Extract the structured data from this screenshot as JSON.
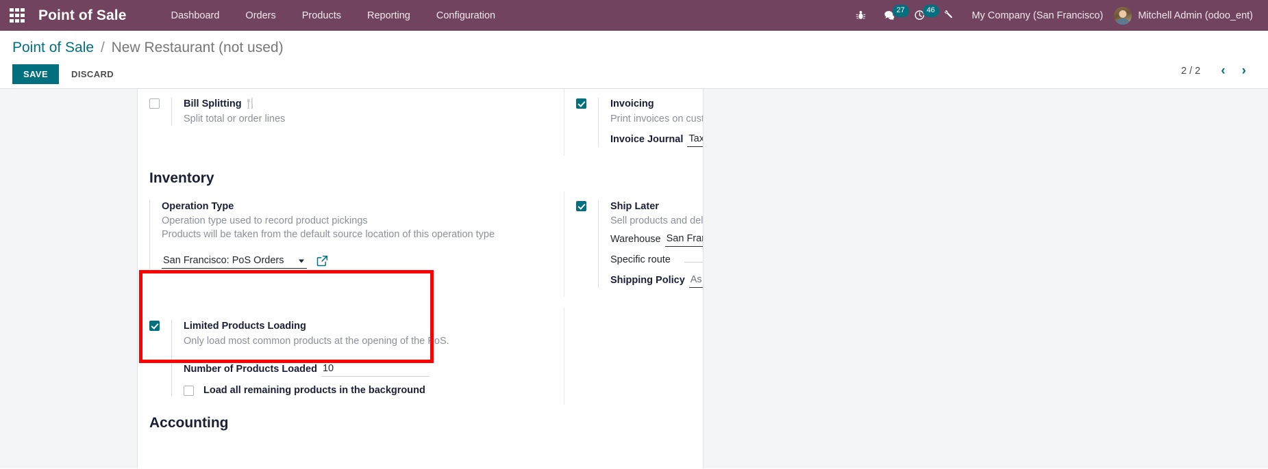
{
  "navbar": {
    "apps_icon": "apps-grid-icon",
    "brand": "Point of Sale",
    "menu": [
      {
        "label": "Dashboard"
      },
      {
        "label": "Orders"
      },
      {
        "label": "Products"
      },
      {
        "label": "Reporting"
      },
      {
        "label": "Configuration"
      }
    ],
    "sys_icons": [
      {
        "name": "bug-icon",
        "glyph": "🐞",
        "badge": null
      },
      {
        "name": "messages-icon",
        "glyph": "💬",
        "badge": "27"
      },
      {
        "name": "activities-clock-icon",
        "glyph": "◔",
        "badge": "46"
      },
      {
        "name": "tools-icon",
        "glyph": "⚒",
        "badge": null
      }
    ],
    "company": "My Company (San Francisco)",
    "user": "Mitchell Admin (odoo_ent)"
  },
  "control_panel": {
    "breadcrumb_root": "Point of Sale",
    "breadcrumb_sep": "/",
    "breadcrumb_current": "New Restaurant (not used)",
    "save_label": "SAVE",
    "discard_label": "DISCARD",
    "pager_count": "2 / 2",
    "pager_prev": "‹",
    "pager_next": "›"
  },
  "settings": {
    "bill_splitting": {
      "checked": false,
      "title": "Bill Splitting",
      "emoji": "🍴",
      "desc": "Split total or order lines"
    },
    "invoicing": {
      "checked": true,
      "title": "Invoicing",
      "desc": "Print invoices on customer request",
      "journal_label": "Invoice Journal",
      "journal_value": "Tax Invoices",
      "journal_link_icon": "external-link-icon"
    },
    "inventory_heading": "Inventory",
    "operation_type": {
      "title": "Operation Type",
      "desc1": "Operation type used to record product pickings",
      "desc2": "Products will be taken from the default source location of this operation type",
      "value": "San Francisco: PoS Orders",
      "link_icon": "external-link-icon"
    },
    "ship_later": {
      "checked": true,
      "title": "Ship Later",
      "desc": "Sell products and deliver them later.",
      "warehouse_label": "Warehouse",
      "warehouse_value": "San Francisco",
      "warehouse_link_icon": "external-link-icon",
      "route_label": "Specific route",
      "route_value": "",
      "policy_label": "Shipping Policy",
      "policy_value": "As soon as possible"
    },
    "limited_products": {
      "checked": true,
      "title": "Limited Products Loading",
      "desc": "Only load most common products at the opening of the PoS.",
      "count_label": "Number of Products Loaded",
      "count_value": "10",
      "background_checked": false,
      "background_label": "Load all remaining products in the background"
    },
    "accounting_heading": "Accounting",
    "highlight_color": "#ff0000"
  }
}
